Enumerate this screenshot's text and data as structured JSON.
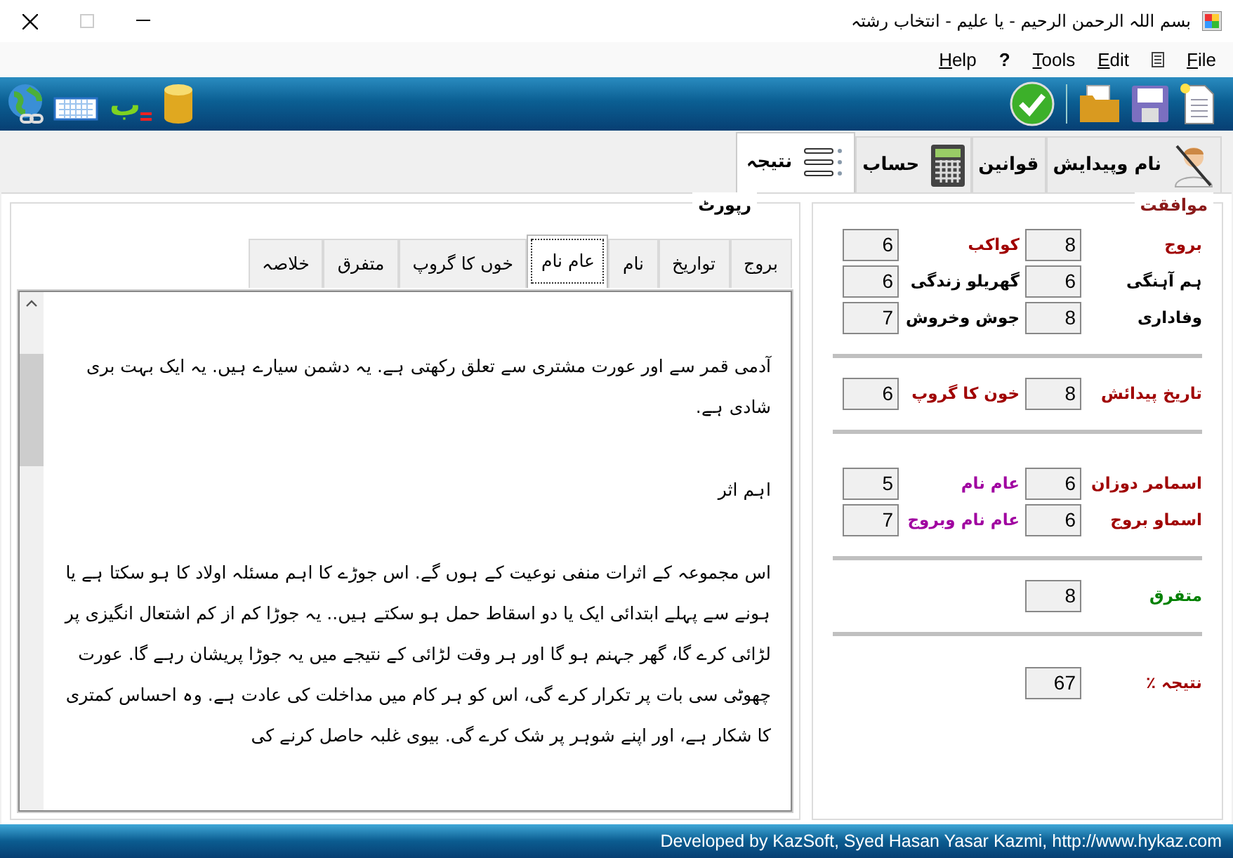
{
  "window": {
    "title": "بسم اللہ الرحمن الرحیم - یا علیم - انتخاب رشتہ"
  },
  "menu": [
    {
      "label": "File"
    },
    {
      "label": "Edit"
    },
    {
      "label": "Tools"
    },
    {
      "label": "?"
    },
    {
      "label": "Help"
    }
  ],
  "toolbar": {
    "glyph": "ب"
  },
  "tabs": [
    {
      "label": "نام وپیدایش",
      "selected": false
    },
    {
      "label": "قوانین",
      "selected": false
    },
    {
      "label": "حساب",
      "selected": false
    },
    {
      "label": "نتیجہ",
      "selected": true
    }
  ],
  "report": {
    "title": "رپورٹ",
    "tabs": [
      {
        "label": "بروج",
        "selected": false
      },
      {
        "label": "تواریخ",
        "selected": false
      },
      {
        "label": "نام",
        "selected": false
      },
      {
        "label": "عام نام",
        "selected": true
      },
      {
        "label": "خوں کا گروپ",
        "selected": false
      },
      {
        "label": "متفرق",
        "selected": false
      },
      {
        "label": "خلاصہ",
        "selected": false
      }
    ],
    "paragraphs": [
      "آدمی قمر سے اور عورت مشتری سے تعلق رکھتی ہے. یہ دشمن سیارے ہیں. یہ ایک بہت بری شادی ہے.",
      "اہم اثر",
      "اس مجموعہ کے اثرات منفی نوعیت کے ہوں گے. اس جوڑے کا اہم مسئلہ اولاد کا ہو سکتا ہے یا ہونے سے پہلے ابتدائی ایک یا دو اسقاط حمل ہو سکتے ہیں.. یہ جوڑا کم از کم اشتعال انگیزی پر لڑائی کرے گا، گھر جہنم ہو گا اور ہر وقت لڑائی کے نتیجے میں یہ جوڑا پریشان رہے گا. عورت چھوٹی سی بات پر تکرار کرے گی، اس کو ہر کام میں مداخلت کی عادت ہے. وہ احساس کمتری کا شکار ہے، اور اپنے شوہر پر شک کرے گی. بیوی غلبہ حاصل کرنے کی"
    ]
  },
  "compatibility": {
    "title": "موافقت",
    "sections": [
      {
        "rows": [
          [
            {
              "label": "بروج",
              "value": "8",
              "color": "#a00000"
            },
            {
              "label": "کواکب",
              "value": "6",
              "color": "#a00000"
            }
          ],
          [
            {
              "label": "ہم آہنگی",
              "value": "6",
              "color": "#000000"
            },
            {
              "label": "گھریلو زندگی",
              "value": "6",
              "color": "#000000"
            }
          ],
          [
            {
              "label": "وفاداری",
              "value": "8",
              "color": "#000000"
            },
            {
              "label": "جوش وخروش",
              "value": "7",
              "color": "#000000"
            }
          ]
        ]
      },
      {
        "rows": [
          [
            {
              "label": "تاریخ پیدائش",
              "value": "8",
              "color": "#a00000"
            },
            {
              "label": "خون کا گروپ",
              "value": "6",
              "color": "#a00000"
            }
          ]
        ]
      },
      {
        "rows": [
          [
            {
              "label": "اسمامر دوزان",
              "value": "6",
              "color": "#a00000"
            },
            {
              "label": "عام نام",
              "value": "5",
              "color": "#a000a0"
            }
          ],
          [
            {
              "label": "اسماو بروج",
              "value": "6",
              "color": "#a00000"
            },
            {
              "label": "عام نام وبروج",
              "value": "7",
              "color": "#a000a0"
            }
          ]
        ]
      },
      {
        "rows": [
          [
            {
              "label": "متفرق",
              "value": "8",
              "color": "#008000"
            }
          ]
        ]
      },
      {
        "rows": [
          [
            {
              "label": "نتیجہ ٪",
              "value": "67",
              "color": "#a00000"
            }
          ]
        ]
      }
    ]
  },
  "status_bar": "Developed by KazSoft, Syed Hasan Yasar Kazmi, http://www.hykaz.com"
}
